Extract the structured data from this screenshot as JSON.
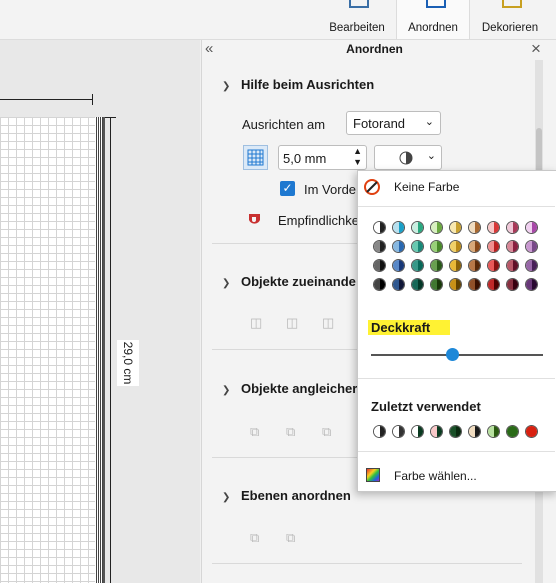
{
  "ribbon": {
    "tabs": [
      {
        "label": "Bearbeiten"
      },
      {
        "label": "Anordnen"
      },
      {
        "label": "Dekorieren"
      }
    ]
  },
  "canvas": {
    "height_label": "29,0 cm"
  },
  "panel": {
    "title": "Anordnen",
    "collapse_glyph": "«",
    "close_glyph": "×",
    "section_align": {
      "title": "Hilfe beim Ausrichten",
      "align_label": "Ausrichten am",
      "align_value": "Fotorand",
      "spacing_value": "5,0 mm",
      "snap_checkbox_label": "Im Vorde",
      "sensitivity_label": "Empfindlichke"
    },
    "section_relative": {
      "title": "Objekte zueinande"
    },
    "section_match": {
      "title": "Objekte angleicher"
    },
    "section_layers": {
      "title": "Ebenen anordnen"
    }
  },
  "color_popup": {
    "no_color_label": "Keine Farbe",
    "opacity_label": "Deckkraft",
    "opacity_value": 0.47,
    "recent_label": "Zuletzt verwendet",
    "choose_label": "Farbe wählen...",
    "palette": [
      [
        [
          "#ffffff",
          "#222222"
        ],
        [
          "#b8e0ee",
          "#1aa0c8"
        ],
        [
          "#c8eee0",
          "#2aa880"
        ],
        [
          "#d8f0c0",
          "#6aa840"
        ],
        [
          "#f8e8b0",
          "#c8a030"
        ],
        [
          "#f0dcc0",
          "#a86830"
        ],
        [
          "#f8c8c8",
          "#d83838"
        ],
        [
          "#f0c8d8",
          "#a83858"
        ],
        [
          "#f0d0f0",
          "#a848a8"
        ]
      ],
      [
        [
          "#888888",
          "#222222"
        ],
        [
          "#88b8e0",
          "#2868b0"
        ],
        [
          "#68c8b0",
          "#188878"
        ],
        [
          "#98d078",
          "#488828"
        ],
        [
          "#f0d068",
          "#b88818"
        ],
        [
          "#d8a878",
          "#884818"
        ],
        [
          "#f09090",
          "#b82020"
        ],
        [
          "#d88898",
          "#882040"
        ],
        [
          "#c898d0",
          "#784888"
        ]
      ],
      [
        [
          "#666666",
          "#111111"
        ],
        [
          "#5888c8",
          "#183878"
        ],
        [
          "#389888",
          "#086858"
        ],
        [
          "#68a050",
          "#285818"
        ],
        [
          "#e8b838",
          "#886008"
        ],
        [
          "#b87848",
          "#582808"
        ],
        [
          "#e85858",
          "#881010"
        ],
        [
          "#b85868",
          "#601028"
        ],
        [
          "#9868a8",
          "#482058"
        ]
      ],
      [
        [
          "#444444",
          "#000000"
        ],
        [
          "#305890",
          "#101838"
        ],
        [
          "#186858",
          "#043828"
        ],
        [
          "#407830",
          "#183808"
        ],
        [
          "#c89018",
          "#604000"
        ],
        [
          "#905028",
          "#381000"
        ],
        [
          "#c02828",
          "#500000"
        ],
        [
          "#883040",
          "#380010"
        ],
        [
          "#683878",
          "#280830"
        ]
      ]
    ],
    "recent_colors": [
      [
        "#ffffff",
        "#222222"
      ],
      [
        "#ffffff",
        "#333333"
      ],
      [
        "#ffffff",
        "#0a3a20"
      ],
      [
        "#f8c8c8",
        "#0a3a20"
      ],
      [
        "#1a5028",
        "#0a2a10"
      ],
      [
        "#f0dcc0",
        "#1a1a1a"
      ],
      [
        "#b8e0a0",
        "#2a5a10"
      ],
      [
        "#2a6a18",
        "#2a6a18"
      ],
      [
        "#d82010",
        "#d82010"
      ]
    ],
    "colors": {
      "highlight": "#fff233",
      "slider_thumb": "#1e88d8",
      "checkbox": "#1e78d0",
      "magnet": "#c83030"
    }
  }
}
